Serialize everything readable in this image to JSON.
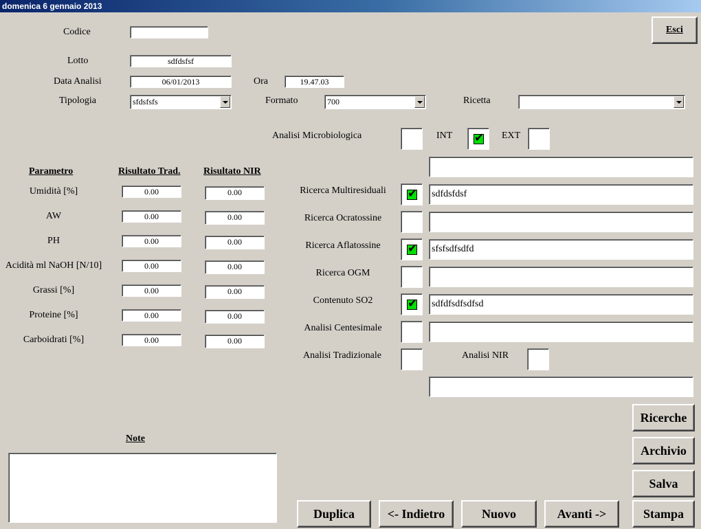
{
  "window": {
    "title": "domenica 6 gennaio 2013"
  },
  "header": {
    "codice_label": "Codice",
    "codice_value": "",
    "lotto_label": "Lotto",
    "lotto_value": "sdfdsfsf",
    "data_label": "Data Analisi",
    "data_value": "06/01/2013",
    "ora_label": "Ora",
    "ora_value": "19.47.03",
    "tipologia_label": "Tipologia",
    "tipologia_value": "sfdsfsfs",
    "formato_label": "Formato",
    "formato_value": "700",
    "ricetta_label": "Ricetta",
    "ricetta_value": ""
  },
  "microbio": {
    "label": "Analisi Microbiologica",
    "int_label": "INT",
    "ext_label": "EXT",
    "int": true,
    "ext": false,
    "unchecked": false
  },
  "params": {
    "headers": {
      "parametro": "Parametro",
      "trad": "Risultato Trad.",
      "nir": "Risultato NIR"
    },
    "rows": [
      {
        "name": "Umidità [%]",
        "trad": "0.00",
        "nir": "0.00"
      },
      {
        "name": "AW",
        "trad": "0.00",
        "nir": "0.00"
      },
      {
        "name": "PH",
        "trad": "0.00",
        "nir": "0.00"
      },
      {
        "name": "Acidità ml NaOH [N/10]",
        "trad": "0.00",
        "nir": "0.00"
      },
      {
        "name": "Grassi [%]",
        "trad": "0.00",
        "nir": "0.00"
      },
      {
        "name": "Proteine [%]",
        "trad": "0.00",
        "nir": "0.00"
      },
      {
        "name": "Carboidrati [%]",
        "trad": "0.00",
        "nir": "0.00"
      }
    ]
  },
  "ricerche": {
    "top_field": "",
    "rows": [
      {
        "label": "Ricerca Multiresiduali",
        "checked": true,
        "value": "sdfdsfdsf"
      },
      {
        "label": "Ricerca Ocratossine",
        "checked": false,
        "value": ""
      },
      {
        "label": "Ricerca Aflatossine",
        "checked": true,
        "value": "sfsfsdfsdfd"
      },
      {
        "label": "Ricerca OGM",
        "checked": false,
        "value": ""
      },
      {
        "label": "Contenuto SO2",
        "checked": true,
        "value": "sdfdfsdfsdfsd"
      },
      {
        "label": "Analisi Centesimale",
        "checked": false,
        "value": ""
      }
    ],
    "tradizionale_label": "Analisi Tradizionale",
    "nir_label": "Analisi NIR",
    "bottom_field": ""
  },
  "note": {
    "label": "Note",
    "value": ""
  },
  "buttons": {
    "esci": "Esci",
    "ricerche": "Ricerche",
    "archivio": "Archivio",
    "salva": "Salva",
    "stampa": "Stampa",
    "duplica": "Duplica",
    "indietro": "<- Indietro",
    "nuovo": "Nuovo",
    "avanti": "Avanti ->"
  },
  "colors": {
    "check_fill": "#00e000",
    "face": "#d4d0c8",
    "title_start": "#0a246a"
  }
}
